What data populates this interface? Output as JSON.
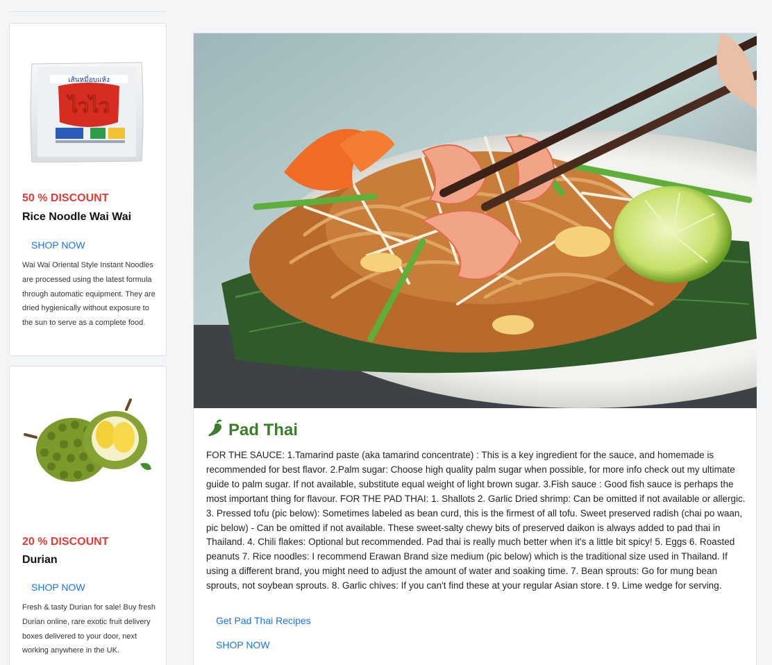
{
  "sidebar": {
    "products": [
      {
        "discount": "50 % DISCOUNT",
        "name": "Rice Noodle Wai Wai",
        "shop_label": "SHOP NOW",
        "description": "Wai Wai Oriental Style Instant Noodles are processed using the latest formula through automatic equipment. They are dried hygienically without exposure to the sun to serve as a complete food.",
        "package_text": "เส้นหมี่อบแห้ง",
        "package_logo": "ไวไว"
      },
      {
        "discount": "20 % DISCOUNT",
        "name": "Durian",
        "shop_label": "SHOP NOW",
        "description": "Fresh & tasty Durian for sale! Buy fresh Durian online, rare exotic fruit delivery boxes delivered to your door, next working anywhere in the UK."
      }
    ]
  },
  "article": {
    "title": "Pad Thai",
    "title_icon": "chili-pepper-icon",
    "body": "FOR THE SAUCE: 1.Tamarind paste (aka tamarind concentrate) : This is a key ingredient for the sauce, and homemade is recommended for best flavor. 2.Palm sugar: Choose high quality palm sugar when possible, for more info check out my ultimate guide to palm sugar. If not available, substitute equal weight of light brown sugar. 3.Fish sauce : Good fish sauce is perhaps the most important thing for flavour. FOR THE PAD THAI: 1. Shallots 2. Garlic Dried shrimp: Can be omitted if not available or allergic. 3. Pressed tofu (pic below): Sometimes labeled as bean curd, this is the firmest of all tofu. Sweet preserved radish (chai po waan, pic below) - Can be omitted if not available. These sweet-salty chewy bits of preserved daikon is always added to pad thai in Thailand. 4. Chili flakes: Optional but recommended. Pad thai is really much better when it's a little bit spicy! 5. Eggs 6. Roasted peanuts 7. Rice noodles: I recommend Erawan Brand size medium (pic below) which is the traditional size used in Thailand. If using a different brand, you might need to adjust the amount of water and soaking time. 7. Bean sprouts: Go for mung bean sprouts, not soybean sprouts. 8. Garlic chives: If you can't find these at your regular Asian store. t 9. Lime wedge for serving.",
    "recipe_link": "Get Pad Thai Recipes",
    "shop_label": "SHOP NOW"
  },
  "colors": {
    "discount": "#e53935",
    "link": "#1a73e8",
    "title": "#3b7d2b"
  }
}
